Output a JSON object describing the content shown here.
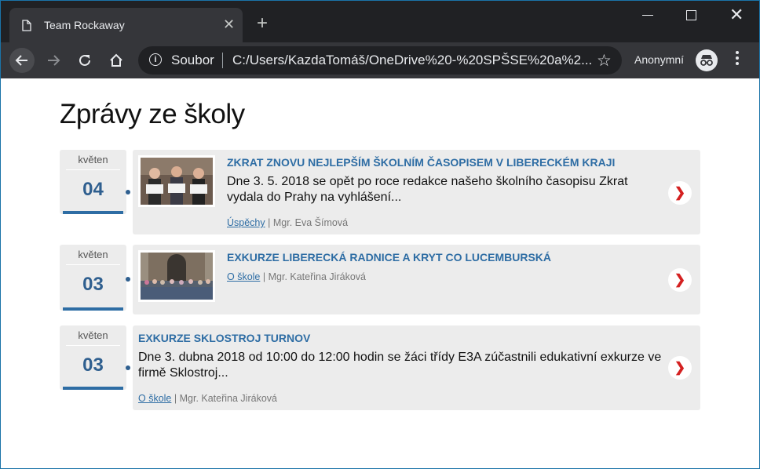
{
  "browser": {
    "tab_title": "Team Rockaway",
    "protocol_label": "Soubor",
    "url": "C:/Users/KazdaTomáš/OneDrive%20-%20SPŠSE%20a%2...",
    "incognito_label": "Anonymní"
  },
  "page": {
    "heading": "Zprávy ze školy",
    "news": [
      {
        "month": "květen",
        "day": "04",
        "title": "Zkrat znovu nejlepším školním časopisem v Libereckém kraji",
        "text": "Dne 3. 5. 2018 se opět po roce redakce našeho školního časopisu Zkrat vydala do Prahy na vyhlášení...",
        "category": "Úspěchy",
        "author": "Mgr. Eva Šímová"
      },
      {
        "month": "květen",
        "day": "03",
        "title": "Exkurze Liberecká radnice a kryt CO Lucemburská",
        "text": "",
        "category": "O škole",
        "author": "Mgr. Kateřina Jiráková"
      },
      {
        "month": "květen",
        "day": "03",
        "title": "Exkurze Sklostroj Turnov",
        "text": "Dne 3. dubna 2018 od 10:00 do 12:00 hodin se žáci třídy E3A zúčastnili edukativní exkurze ve firmě Sklostroj...",
        "category": "O škole",
        "author": "Mgr. Kateřina Jiráková"
      }
    ],
    "meta_separator": "|"
  },
  "colors": {
    "accent": "#2e6da4",
    "arrow": "#d42020",
    "card_bg": "#ececec"
  }
}
